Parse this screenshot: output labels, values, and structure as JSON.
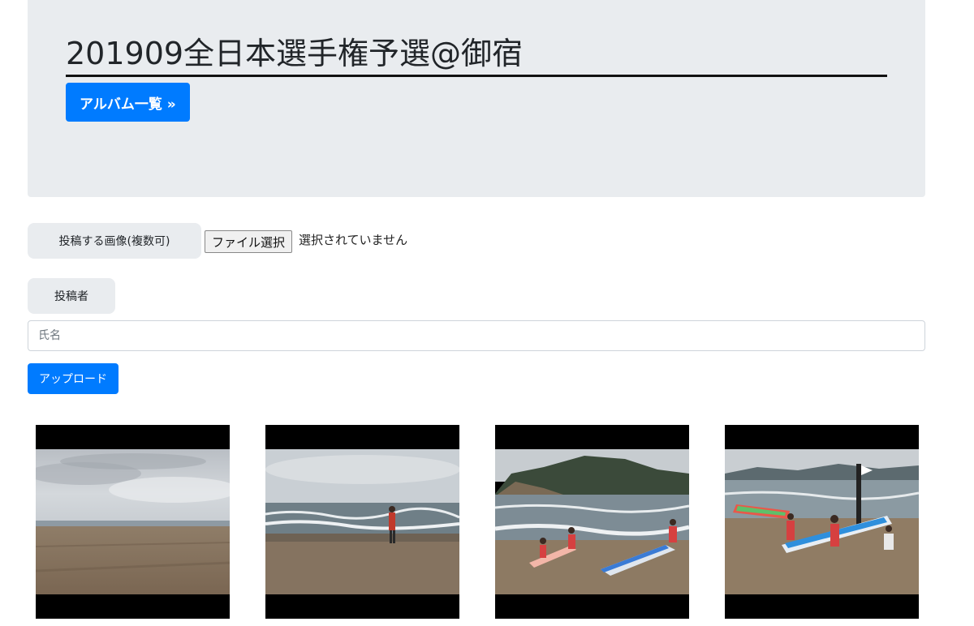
{
  "header": {
    "title": "201909全日本選手権予選@御宿",
    "album_button": "アルバム一覧 »"
  },
  "upload_form": {
    "images_label": "投稿する画像(複数可)",
    "file_button": "ファイル選択",
    "file_status": "選択されていません",
    "poster_label": "投稿者",
    "name_placeholder": "氏名",
    "name_value": "",
    "upload_button": "アップロード"
  },
  "gallery": {
    "photos": [
      {
        "subject": "cloudy sky over empty beach"
      },
      {
        "subject": "lifeguard standing on beach by waves"
      },
      {
        "subject": "competitors carrying boards near cliffs"
      },
      {
        "subject": "competitors carrying paddleboards on beach"
      }
    ]
  },
  "colors": {
    "primary": "#007bff",
    "jumbotron": "#e9ecef"
  }
}
